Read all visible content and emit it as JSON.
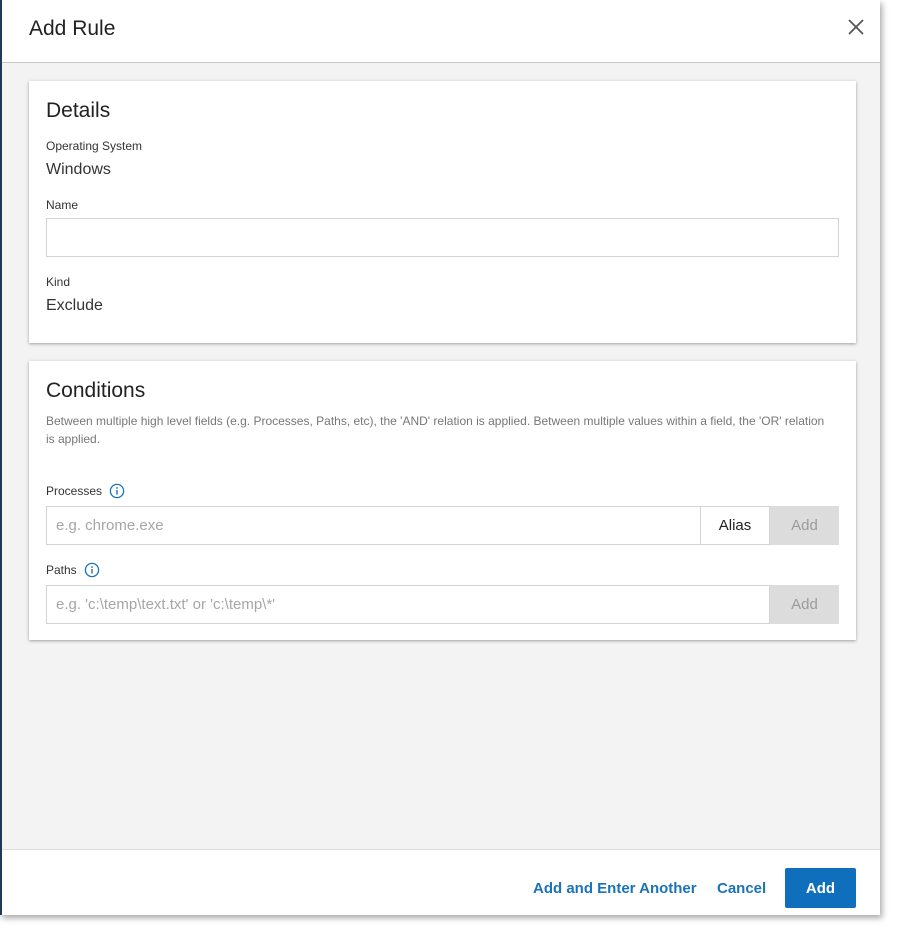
{
  "dialog": {
    "title": "Add Rule"
  },
  "details": {
    "title": "Details",
    "os_label": "Operating System",
    "os_value": "Windows",
    "name_label": "Name",
    "name_value": "",
    "kind_label": "Kind",
    "kind_value": "Exclude"
  },
  "conditions": {
    "title": "Conditions",
    "description": "Between multiple high level fields (e.g. Processes, Paths, etc), the 'AND' relation is applied. Between multiple values within a field, the 'OR' relation is applied.",
    "processes_label": "Processes",
    "processes_placeholder": "e.g. chrome.exe",
    "alias_label": "Alias",
    "processes_add_label": "Add",
    "paths_label": "Paths",
    "paths_placeholder": "e.g. 'c:\\temp\\text.txt' or 'c:\\temp\\*'",
    "paths_add_label": "Add"
  },
  "footer": {
    "add_another_label": "Add and Enter Another",
    "cancel_label": "Cancel",
    "add_label": "Add"
  },
  "colors": {
    "accent": "#0f6fbd",
    "link": "#1a73b8",
    "info_icon": "#1a73b8",
    "disabled_bg": "#dcdcdc"
  },
  "icons": {
    "close": "close-icon",
    "info": "info-icon"
  }
}
